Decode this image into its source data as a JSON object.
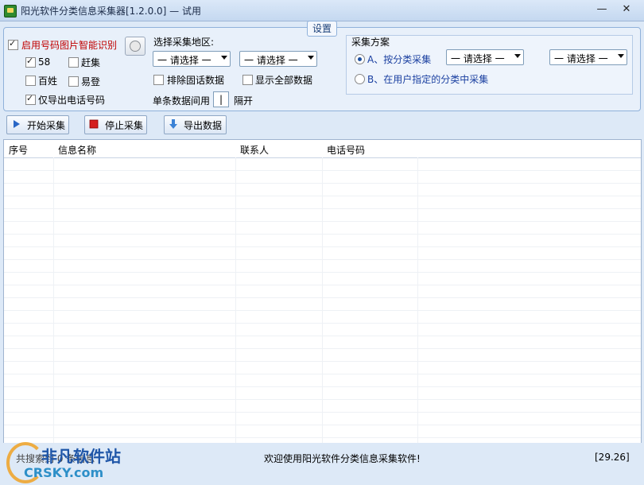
{
  "window": {
    "title": "阳光软件分类信息采集器[1.2.0.0] — 试用",
    "minimize_glyph": "—",
    "close_glyph": "✕"
  },
  "settings": {
    "caption": "设置",
    "smart_ocr": {
      "label": "启用号码图片智能识别",
      "checked": true
    },
    "sources": [
      {
        "label": "58",
        "checked": true
      },
      {
        "label": "赶集",
        "checked": false
      },
      {
        "label": "百姓",
        "checked": false
      },
      {
        "label": "易登",
        "checked": false
      }
    ],
    "phone_only": {
      "label": "仅导出电话号码",
      "checked": true
    },
    "region": {
      "label": "选择采集地区:",
      "select1": "一 请选择 一",
      "select2": "一 请选择 一"
    },
    "exclude_landline": {
      "label": "排除固话数据",
      "checked": false
    },
    "show_all": {
      "label": "显示全部数据",
      "checked": false
    },
    "interval": {
      "prefix": "单条数据间用",
      "value": "|",
      "suffix": "隔开"
    },
    "scheme": {
      "title": "采集方案",
      "option_a": {
        "label": "A、按分类采集",
        "selected": true
      },
      "option_b": {
        "label": "B、在用户指定的分类中采集",
        "selected": false
      },
      "select1": "一 请选择 一",
      "select2": "一 请选择 一"
    }
  },
  "toolbar": {
    "start": "开始采集",
    "stop": "停止采集",
    "export": "导出数据"
  },
  "table": {
    "columns": [
      "序号",
      "信息名称",
      "联系人",
      "电话号码"
    ],
    "rows": []
  },
  "status": {
    "left": "共搜索到 0 条信息",
    "center": "欢迎使用阳光软件分类信息采集软件!",
    "right": "[29.26]"
  },
  "watermark": {
    "line1": "非凡软件站",
    "line2": "CRSKY.com"
  },
  "colors": {
    "accent": "#1a3fa0",
    "warning_text": "#c00000",
    "background": "#dde9f7"
  },
  "icons": {
    "start": "play-icon",
    "stop": "stop-icon",
    "export": "down-arrow-icon"
  }
}
